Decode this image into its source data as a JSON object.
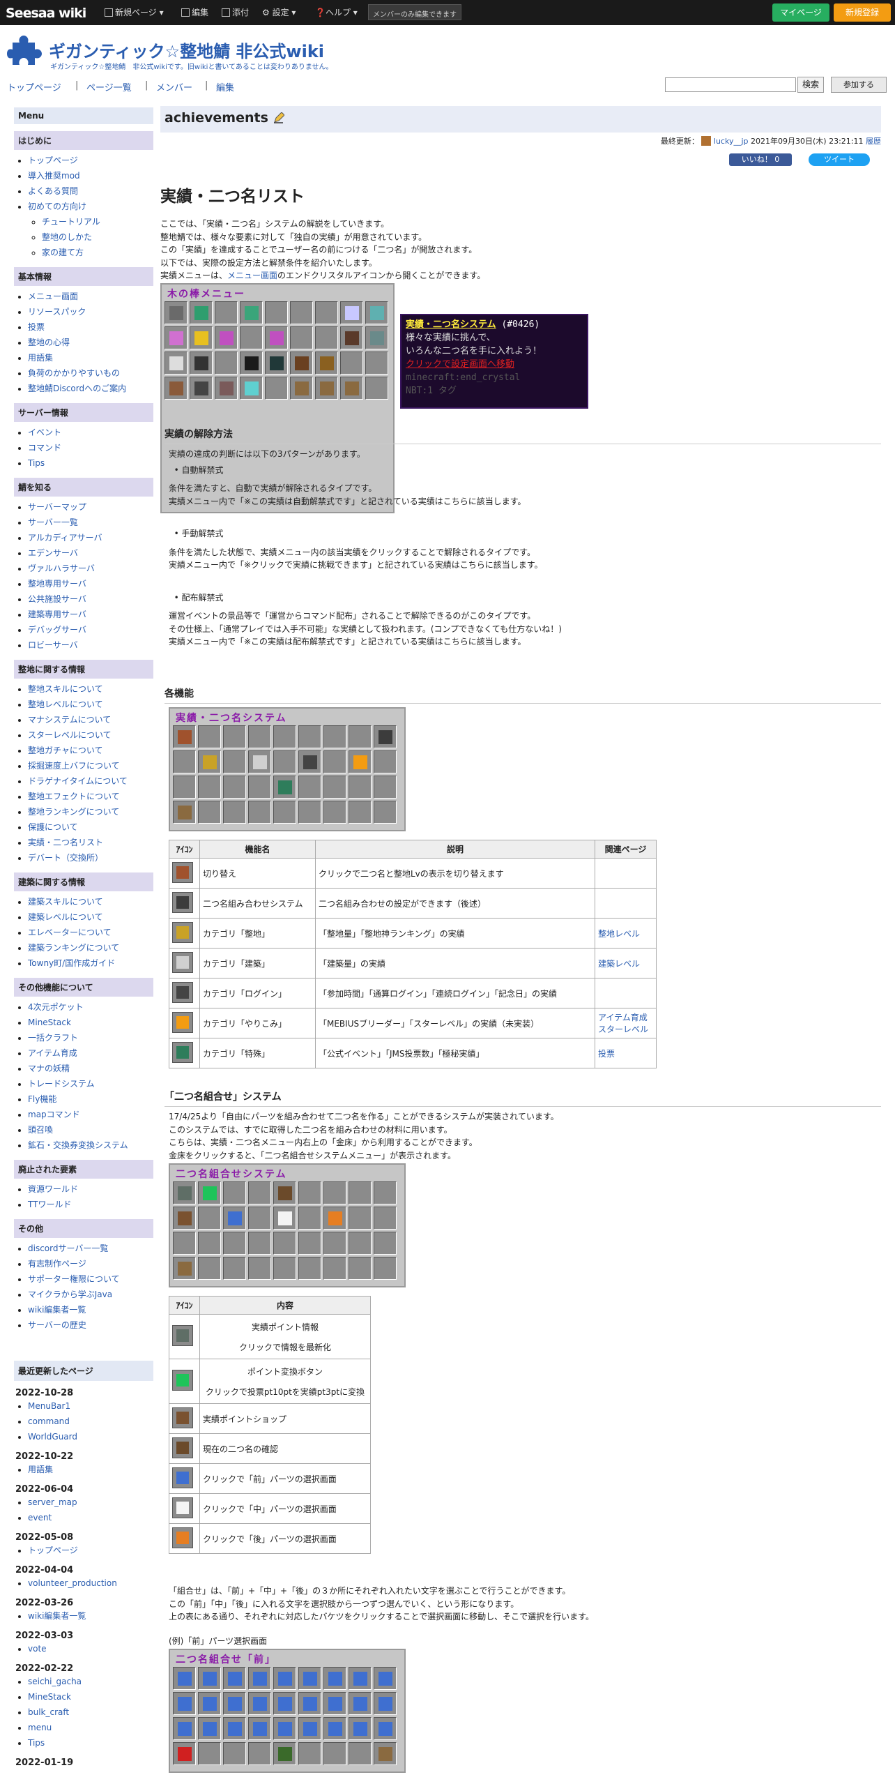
{
  "topbar": {
    "logo": "Seesaa wiki",
    "items": [
      "新規ページ",
      "編集",
      "添付",
      "設定",
      "ヘルプ"
    ],
    "member_note": "メンバーのみ編集できます",
    "mypage": "マイページ",
    "register": "新規登録"
  },
  "header": {
    "title": "ギガンティック☆整地鯖 非公式wiki",
    "subtitle": "ギガンティック☆整地鯖　非公式wikiです。旧wikiと書いてあることは変わりありません。"
  },
  "nav": {
    "items": [
      "トップページ",
      "ページ一覧",
      "メンバー",
      "編集"
    ],
    "search_button": "検索",
    "join_button": "参加する"
  },
  "sidebar": {
    "menu_title": "Menu",
    "sections": [
      {
        "title": "はじめに",
        "items": [
          "トップページ",
          "導入推奨mod",
          "よくある質問",
          "初めての方向け"
        ],
        "sub": [
          "チュートリアル",
          "整地のしかた",
          "家の建て方"
        ]
      },
      {
        "title": "基本情報",
        "items": [
          "メニュー画面",
          "リソースパック",
          "投票",
          "整地の心得",
          "用語集",
          "負荷のかかりやすいもの",
          "整地鯖Discordへのご案内"
        ]
      },
      {
        "title": "サーバー情報",
        "items": [
          "イベント",
          "コマンド",
          "Tips"
        ]
      },
      {
        "title": "鯖を知る",
        "items": [
          "サーバーマップ",
          "サーバー一覧",
          "アルカディアサーバ",
          "エデンサーバ",
          "ヴァルハラサーバ",
          "整地専用サーバ",
          "公共施設サーバ",
          "建築専用サーバ",
          "デバッグサーバ",
          "ロビーサーバ"
        ]
      },
      {
        "title": "整地に関する情報",
        "items": [
          "整地スキルについて",
          "整地レベルについて",
          "マナシステムについて",
          "スターレベルについて",
          "整地ガチャについて",
          "採掘速度上バフについて",
          "ドラゲナイタイムについて",
          "整地エフェクトについて",
          "整地ランキングについて",
          "保護について",
          "実績・二つ名リスト",
          "デバート（交換所）"
        ]
      },
      {
        "title": "建築に関する情報",
        "items": [
          "建築スキルについて",
          "建築レベルについて",
          "エレベーターについて",
          "建築ランキングについて",
          "Towny町/国作成ガイド"
        ]
      },
      {
        "title": "その他機能について",
        "items": [
          "4次元ポケット",
          "MineStack",
          "一括クラフト",
          "アイテム育成",
          "マナの妖精",
          "トレードシステム",
          "Fly機能",
          "mapコマンド",
          "頭召喚",
          "鉱石・交換券変換システム"
        ]
      },
      {
        "title": "廃止された要素",
        "items": [
          "資源ワールド",
          "TTワールド"
        ]
      },
      {
        "title": "その他",
        "items": [
          "discordサーバー一覧",
          "有志制作ページ",
          "サポーター権限について",
          "マイクラから学ぶJava",
          "wiki編集者一覧",
          "サーバーの歴史"
        ]
      }
    ],
    "recent_title": "最近更新したページ",
    "recent": [
      {
        "date": "2022-10-28",
        "pages": [
          "MenuBar1",
          "command",
          "WorldGuard"
        ]
      },
      {
        "date": "2022-10-22",
        "pages": [
          "用語集"
        ]
      },
      {
        "date": "2022-06-04",
        "pages": [
          "server_map",
          "event"
        ]
      },
      {
        "date": "2022-05-08",
        "pages": [
          "トップページ"
        ]
      },
      {
        "date": "2022-04-04",
        "pages": [
          "volunteer_production"
        ]
      },
      {
        "date": "2022-03-26",
        "pages": [
          "wiki編集者一覧"
        ]
      },
      {
        "date": "2022-03-03",
        "pages": [
          "vote"
        ]
      },
      {
        "date": "2022-02-22",
        "pages": [
          "seichi_gacha",
          "MineStack",
          "bulk_craft",
          "menu",
          "Tips"
        ]
      },
      {
        "date": "2022-01-19",
        "pages": []
      }
    ]
  },
  "page": {
    "name": "achievements",
    "lastmod_label": "最終更新：",
    "author": "lucky__jp",
    "lastmod_date": "2021年09月30日(木) 23:21:11",
    "history": "履歴",
    "like": "いいね！ 0",
    "tweet": "ツイート",
    "title": "実績・二つ名リスト",
    "intro": [
      "ここでは、「実績・二つ名」システムの解説をしていきます。",
      "整地鯖では、様々な要素に対して「独自の実績」が用意されています。",
      "この「実績」を達成することでユーザー名の前につける「二つ名」が開放されます。",
      "以下では、実際の設定方法と解禁条件を紹介いたします。"
    ],
    "intro_last_pre": "実績メニューは、",
    "intro_last_link": "メニュー画面",
    "intro_last_post": "のエンドクリスタルアイコンから開くことができます。",
    "gui1_title": "木の棒メニュー",
    "tooltip": {
      "name": "実績・二つ名システム",
      "id": "(#0426)",
      "line1": "様々な実績に挑んで、",
      "line2": "いろんな二つ名を手に入れよう！",
      "line3": "クリックで設定画面へ移動",
      "line4": "minecraft:end_crystal",
      "line5": "NBT:1 タグ"
    }
  },
  "unlock": {
    "heading": "実績の解除方法",
    "lead": "実績の達成の判断には以下の3パターンがあります。",
    "auto_title": "自動解禁式",
    "auto_lines": [
      "条件を満たすと、自動で実績が解除されるタイプです。",
      "実績メニュー内で「※この実績は自動解禁式です」と記されている実績はこちらに該当します。"
    ],
    "manual_title": "手動解禁式",
    "manual_lines": [
      "条件を満たした状態で、実績メニュー内の該当実績をクリックすることで解除されるタイプです。",
      "実績メニュー内で「※クリックで実績に挑戦できます」と記されている実績はこちらに該当します。"
    ],
    "dist_title": "配布解禁式",
    "dist_lines": [
      "運営イベントの景品等で「運営からコマンド配布」されることで解除できるのがこのタイプです。",
      "その仕様上、「通常プレイでは入手不可能」な実績として扱われます。(コンプできなくても仕方ないね！)",
      "実績メニュー内で「※この実績は配布解禁式です」と記されている実績はこちらに該当します。"
    ]
  },
  "features": {
    "heading": "各機能",
    "gui_title": "実績・二つ名システム",
    "table_headers": [
      "ｱｲｺﾝ",
      "機能名",
      "説明",
      "関連ページ"
    ],
    "rows": [
      {
        "name": "切り替え",
        "desc": "クリックで二つ名と整地Lvの表示を切り替えます",
        "links": [],
        "icon": "redstone-torch-icon"
      },
      {
        "name": "二つ名組み合わせシステム",
        "desc": "二つ名組み合わせの設定ができます（後述）",
        "links": [],
        "icon": "bedrock-icon"
      },
      {
        "name": "カテゴリ「整地」",
        "desc": "「整地量」「整地神ランキング」の実績",
        "links": [
          "整地レベル"
        ],
        "icon": "pickaxe-icon"
      },
      {
        "name": "カテゴリ「建築」",
        "desc": "「建築量」の実績",
        "links": [
          "建築レベル"
        ],
        "icon": "glass-pane-icon"
      },
      {
        "name": "カテゴリ「ログイン」",
        "desc": "「参加時間」「通算ログイン」「連続ログイン」「記念日」の実績",
        "links": [],
        "icon": "compass-icon"
      },
      {
        "name": "カテゴリ「やりこみ」",
        "desc": "「MEBIUSブリーダー」「スターレベル」の実績（未実装）",
        "links": [
          "アイテム育成",
          "スターレベル"
        ],
        "icon": "blaze-powder-icon"
      },
      {
        "name": "カテゴリ「特殊」",
        "desc": "「公式イベント」「JMS投票数」「極秘実績」",
        "links": [
          "投票"
        ],
        "icon": "ender-eye-icon"
      }
    ]
  },
  "combo": {
    "heading": "「二つ名組合せ」システム",
    "lines": [
      "17/4/25より「自由にパーツを組み合わせて二つ名を作る」ことができるシステムが実装されています。",
      "このシステムでは、すでに取得した二つ名を組み合わせの材料に用います。",
      "こちらは、実績・二つ名メニュー内右上の「金床」から利用することができます。",
      "金床をクリックすると、「二つ名組合せシステムメニュー」が表示されます。"
    ],
    "gui_title": "二つ名組合せシステム",
    "table_headers": [
      "ｱｲｺﾝ",
      "内容"
    ],
    "rows": [
      {
        "line1": "実績ポイント情報",
        "line2": "クリックで情報を最新化",
        "icon": "stone-icon"
      },
      {
        "line1": "ポイント変換ボタン",
        "line2": "クリックで投票pt10ptを実績pt3ptに変換",
        "icon": "emerald-icon"
      },
      {
        "line1": "実績ポイントショップ",
        "line2": "",
        "icon": "item-frame-icon"
      },
      {
        "line1": "現在の二つ名の確認",
        "line2": "",
        "icon": "book-icon"
      },
      {
        "line1": "クリックで「前」パーツの選択画面",
        "line2": "",
        "icon": "water-bucket-icon"
      },
      {
        "line1": "クリックで「中」パーツの選択画面",
        "line2": "",
        "icon": "milk-bucket-icon"
      },
      {
        "line1": "クリックで「後」パーツの選択画面",
        "line2": "",
        "icon": "lava-bucket-icon"
      }
    ],
    "after": [
      "「組合せ」は、「前」+「中」+「後」の３か所にそれぞれ入れたい文字を選ぶことで行うことができます。",
      "この「前」「中」「後」に入れる文字を選択肢から一つずつ選んでいく、という形になります。",
      "上の表にある通り、それぞれに対応したバケツをクリックすることで選択画面に移動し、そこで選択を行います。"
    ],
    "example": "(例)「前」パーツ選択画面",
    "gui3_title": "二つ名組合せ「前」"
  },
  "colors": {
    "link": "#2a5db0",
    "title_purple": "#8a1aa8",
    "section_bg": "#dcd8ee",
    "head_bg": "#e8ecf6",
    "mypage": "#27ae60",
    "register": "#f39c12"
  }
}
